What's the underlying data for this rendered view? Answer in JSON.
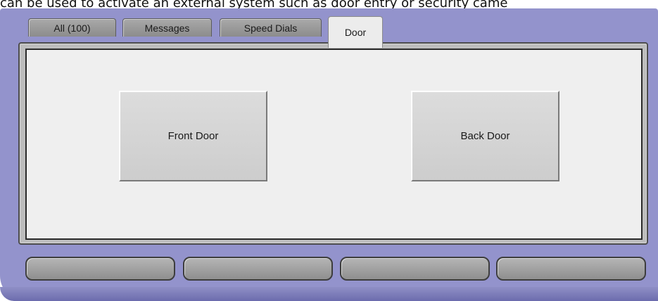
{
  "caption": {
    "text": "can be used to activate an external system such as door entry or security came"
  },
  "tabs": [
    {
      "label": "All (100)",
      "active": false
    },
    {
      "label": "Messages",
      "active": false
    },
    {
      "label": "Speed Dials",
      "active": false
    },
    {
      "label": "Door",
      "active": true
    }
  ],
  "doors": {
    "front_label": "Front Door",
    "back_label": "Back Door"
  },
  "soft_keys": [
    "",
    "",
    "",
    ""
  ],
  "colors": {
    "device_frame": "#9393cc",
    "panel_background": "#efefef",
    "tab_inactive": "#9c9c9c"
  }
}
